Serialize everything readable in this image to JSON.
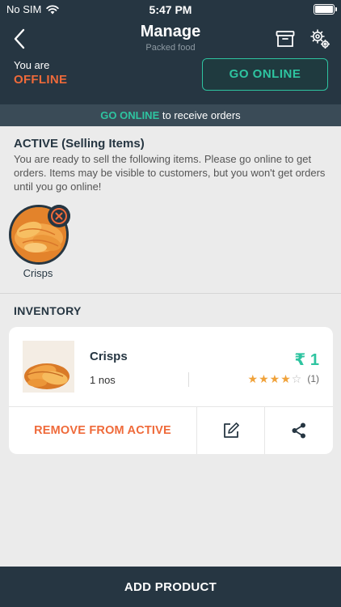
{
  "status_bar": {
    "carrier": "No SIM",
    "time": "5:47 PM"
  },
  "header": {
    "title": "Manage",
    "subtitle": "Packed food",
    "icons": [
      "back-arrow-icon",
      "archive-box-icon",
      "settings-gears-icon"
    ]
  },
  "online_status": {
    "prefix": "You are",
    "state": "OFFLINE",
    "button_label": "GO ONLINE"
  },
  "banner": {
    "highlight": "GO ONLINE",
    "text": " to receive orders"
  },
  "active_section": {
    "heading": "ACTIVE (Selling Items)",
    "description": "You are ready to sell the following items. Please go online to get orders. Items may be visible to customers, but you won't get orders until you go online!",
    "items": [
      {
        "label": "Crisps"
      }
    ]
  },
  "inventory": {
    "heading": "INVENTORY",
    "items": [
      {
        "name": "Crisps",
        "price": "₹ 1",
        "quantity": "1 nos",
        "rating_stars": 4,
        "rating_max": 5,
        "rating_count": "(1)",
        "remove_label": "REMOVE FROM ACTIVE"
      }
    ]
  },
  "footer": {
    "add_product_label": "ADD PRODUCT"
  },
  "colors": {
    "header_bg": "#263642",
    "accent_green": "#2ec4a0",
    "accent_orange": "#ef6a3a",
    "page_bg": "#ebebeb",
    "star": "#f0a23a"
  }
}
